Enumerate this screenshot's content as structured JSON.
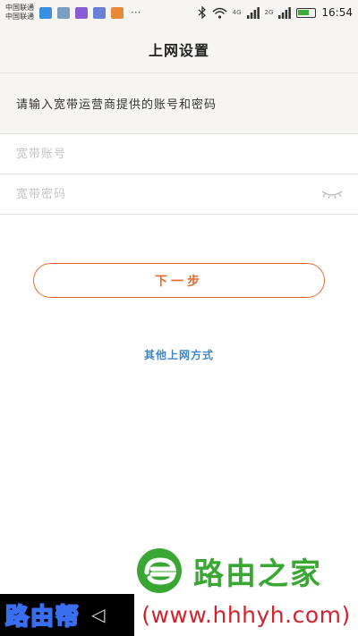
{
  "status_bar": {
    "carrier_line1": "中国联通",
    "carrier_line2": "中国联通",
    "dots": "···",
    "net_4g": "4G",
    "net_2g": "2G",
    "time": "16:54"
  },
  "header": {
    "title": "上网设置"
  },
  "instruction": "请输入宽带运营商提供的账号和密码",
  "form": {
    "account_placeholder": "宽带账号",
    "password_placeholder": "宽带密码",
    "account_value": "",
    "password_value": ""
  },
  "next_button": "下一步",
  "other_methods_link": "其他上网方式",
  "watermark": {
    "site_name": "路由之家",
    "url": "(www.hhhyh.com)",
    "badge": "路由帮"
  },
  "colors": {
    "accent": "#e8692f",
    "link": "#3f85c7",
    "watermark_green": "#3aa734",
    "watermark_red": "#d4232d",
    "header_bg": "#f6f5f3"
  }
}
